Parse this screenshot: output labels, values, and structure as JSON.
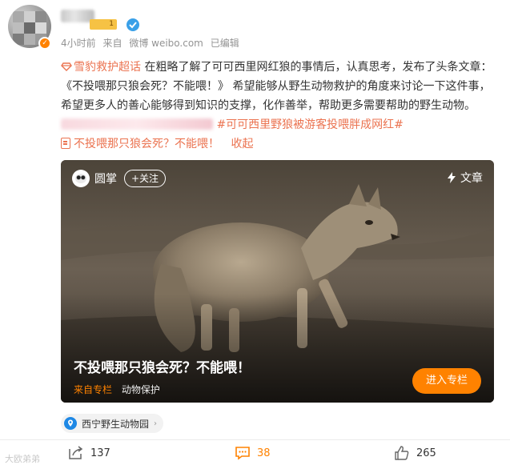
{
  "header": {
    "level_badge": "1",
    "meta": {
      "time": "4小时前",
      "source_prefix": "来自",
      "source": "微博 weibo.com",
      "edited": "已编辑"
    }
  },
  "post": {
    "topic": "雪豹救护超话",
    "text_part1": "在粗略了解了可可西里网红狼的事情后，认真思考，发布了头条文章：《不投喂那只狼会死？不能喂！》 希望能够从野生动物救护的角度来讨论一下这件事，希望更多人的善心能够得到知识的支撑，化作善举，帮助更多需要帮助的野生动物。",
    "hashtag": "#可可西里野狼被游客投喂胖成网红#",
    "article_link": "不投喂那只狼会死？不能喂！",
    "collapse": "收起"
  },
  "card": {
    "account_name": "圆掌",
    "follow_label": "+关注",
    "article_tag": "文章",
    "title": "不投喂那只狼会死？不能喂！",
    "source_label": "来自专栏",
    "category": "动物保护",
    "enter_button": "进入专栏"
  },
  "location": {
    "label": "西宁野生动物园"
  },
  "actions": {
    "repost_count": "137",
    "comment_count": "38",
    "like_count": "265"
  },
  "watermark": "大欧弟弟",
  "colors": {
    "accent_orange": "#ff8200",
    "topic_red": "#eb7350",
    "meta_gray": "#939393"
  }
}
